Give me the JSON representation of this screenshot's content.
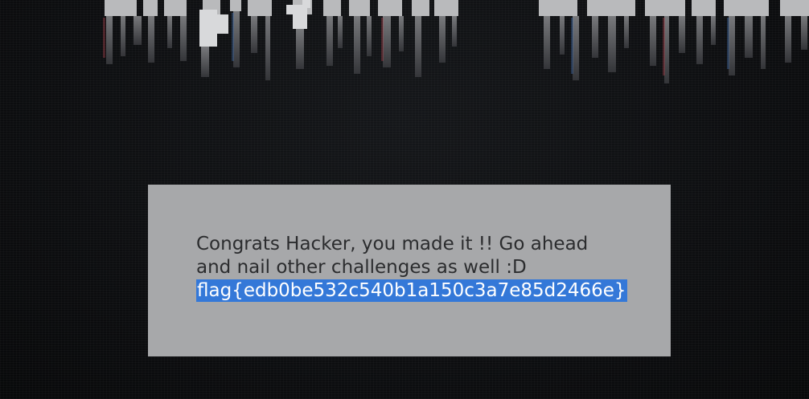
{
  "banner": {
    "text_image": "glitch-ascii-banner"
  },
  "dialog": {
    "line1": "Congrats Hacker, you made it !! Go ahead",
    "line2": "and nail other challenges as well :D",
    "flag": "flag{edb0be532c540b1a150c3a7e85d2466e}"
  },
  "colors": {
    "background": "#0d0e10",
    "dialog_bg": "#a7a8aa",
    "text": "#2b2c2e",
    "selection": "#3478d8"
  }
}
